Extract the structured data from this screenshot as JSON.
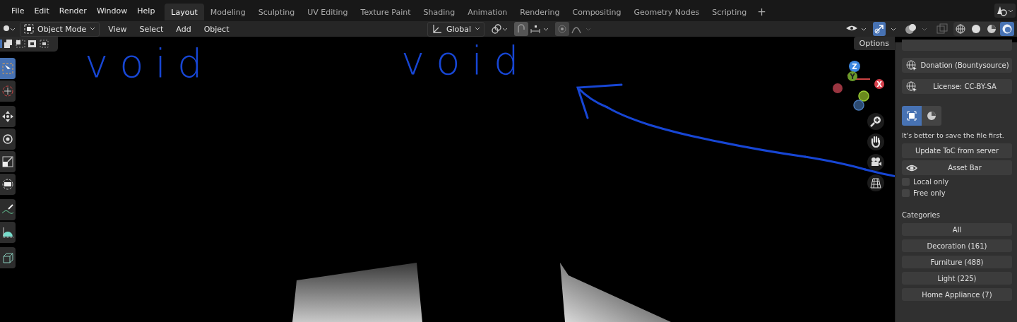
{
  "menu": [
    "File",
    "Edit",
    "Render",
    "Window",
    "Help"
  ],
  "workspaces": [
    {
      "label": "Layout",
      "selected": true
    },
    {
      "label": "Modeling",
      "selected": false
    },
    {
      "label": "Sculpting",
      "selected": false
    },
    {
      "label": "UV Editing",
      "selected": false
    },
    {
      "label": "Texture Paint",
      "selected": false
    },
    {
      "label": "Shading",
      "selected": false
    },
    {
      "label": "Animation",
      "selected": false
    },
    {
      "label": "Rendering",
      "selected": false
    },
    {
      "label": "Compositing",
      "selected": false
    },
    {
      "label": "Geometry Nodes",
      "selected": false
    },
    {
      "label": "Scripting",
      "selected": false
    }
  ],
  "add_workspace": "+",
  "header": {
    "mode": "Object Mode",
    "menus": [
      "View",
      "Select",
      "Add",
      "Object"
    ],
    "orientation": "Global"
  },
  "shading": [
    {
      "kind": "wireframe",
      "selected": false
    },
    {
      "kind": "solid",
      "selected": false
    },
    {
      "kind": "material",
      "selected": false
    },
    {
      "kind": "rendered",
      "selected": true
    }
  ],
  "options_tab": "Options",
  "tools": [
    {
      "kind": "select",
      "selected": true
    },
    {
      "kind": "cursor",
      "selected": false
    },
    {
      "kind": "move",
      "selected": false
    },
    {
      "kind": "rotate",
      "selected": false
    },
    {
      "kind": "scale",
      "selected": false
    },
    {
      "kind": "transform",
      "selected": false
    },
    {
      "kind": "annotate",
      "selected": false
    },
    {
      "kind": "measure",
      "selected": false
    },
    {
      "kind": "cube",
      "selected": false
    }
  ],
  "gizmo": {
    "axes": [
      "Z",
      "Y",
      "X"
    ]
  },
  "annotations": [
    "void",
    "void"
  ],
  "sidebar": {
    "links": [
      "Donation (Bountysource)",
      "License: CC-BY-SA"
    ],
    "mode_buttons": [
      {
        "kind": "scene",
        "selected": true
      },
      {
        "kind": "material",
        "selected": false
      }
    ],
    "hint": "It's better to save the file first.",
    "update_button": "Update ToC from server",
    "asset_bar": "Asset Bar",
    "filters": [
      {
        "label": "Local only",
        "checked": false
      },
      {
        "label": "Free only",
        "checked": false
      }
    ],
    "categories_title": "Categories",
    "categories": [
      "All",
      "Decoration (161)",
      "Furniture (488)",
      "Light (225)",
      "Home Appliance (7)"
    ]
  }
}
